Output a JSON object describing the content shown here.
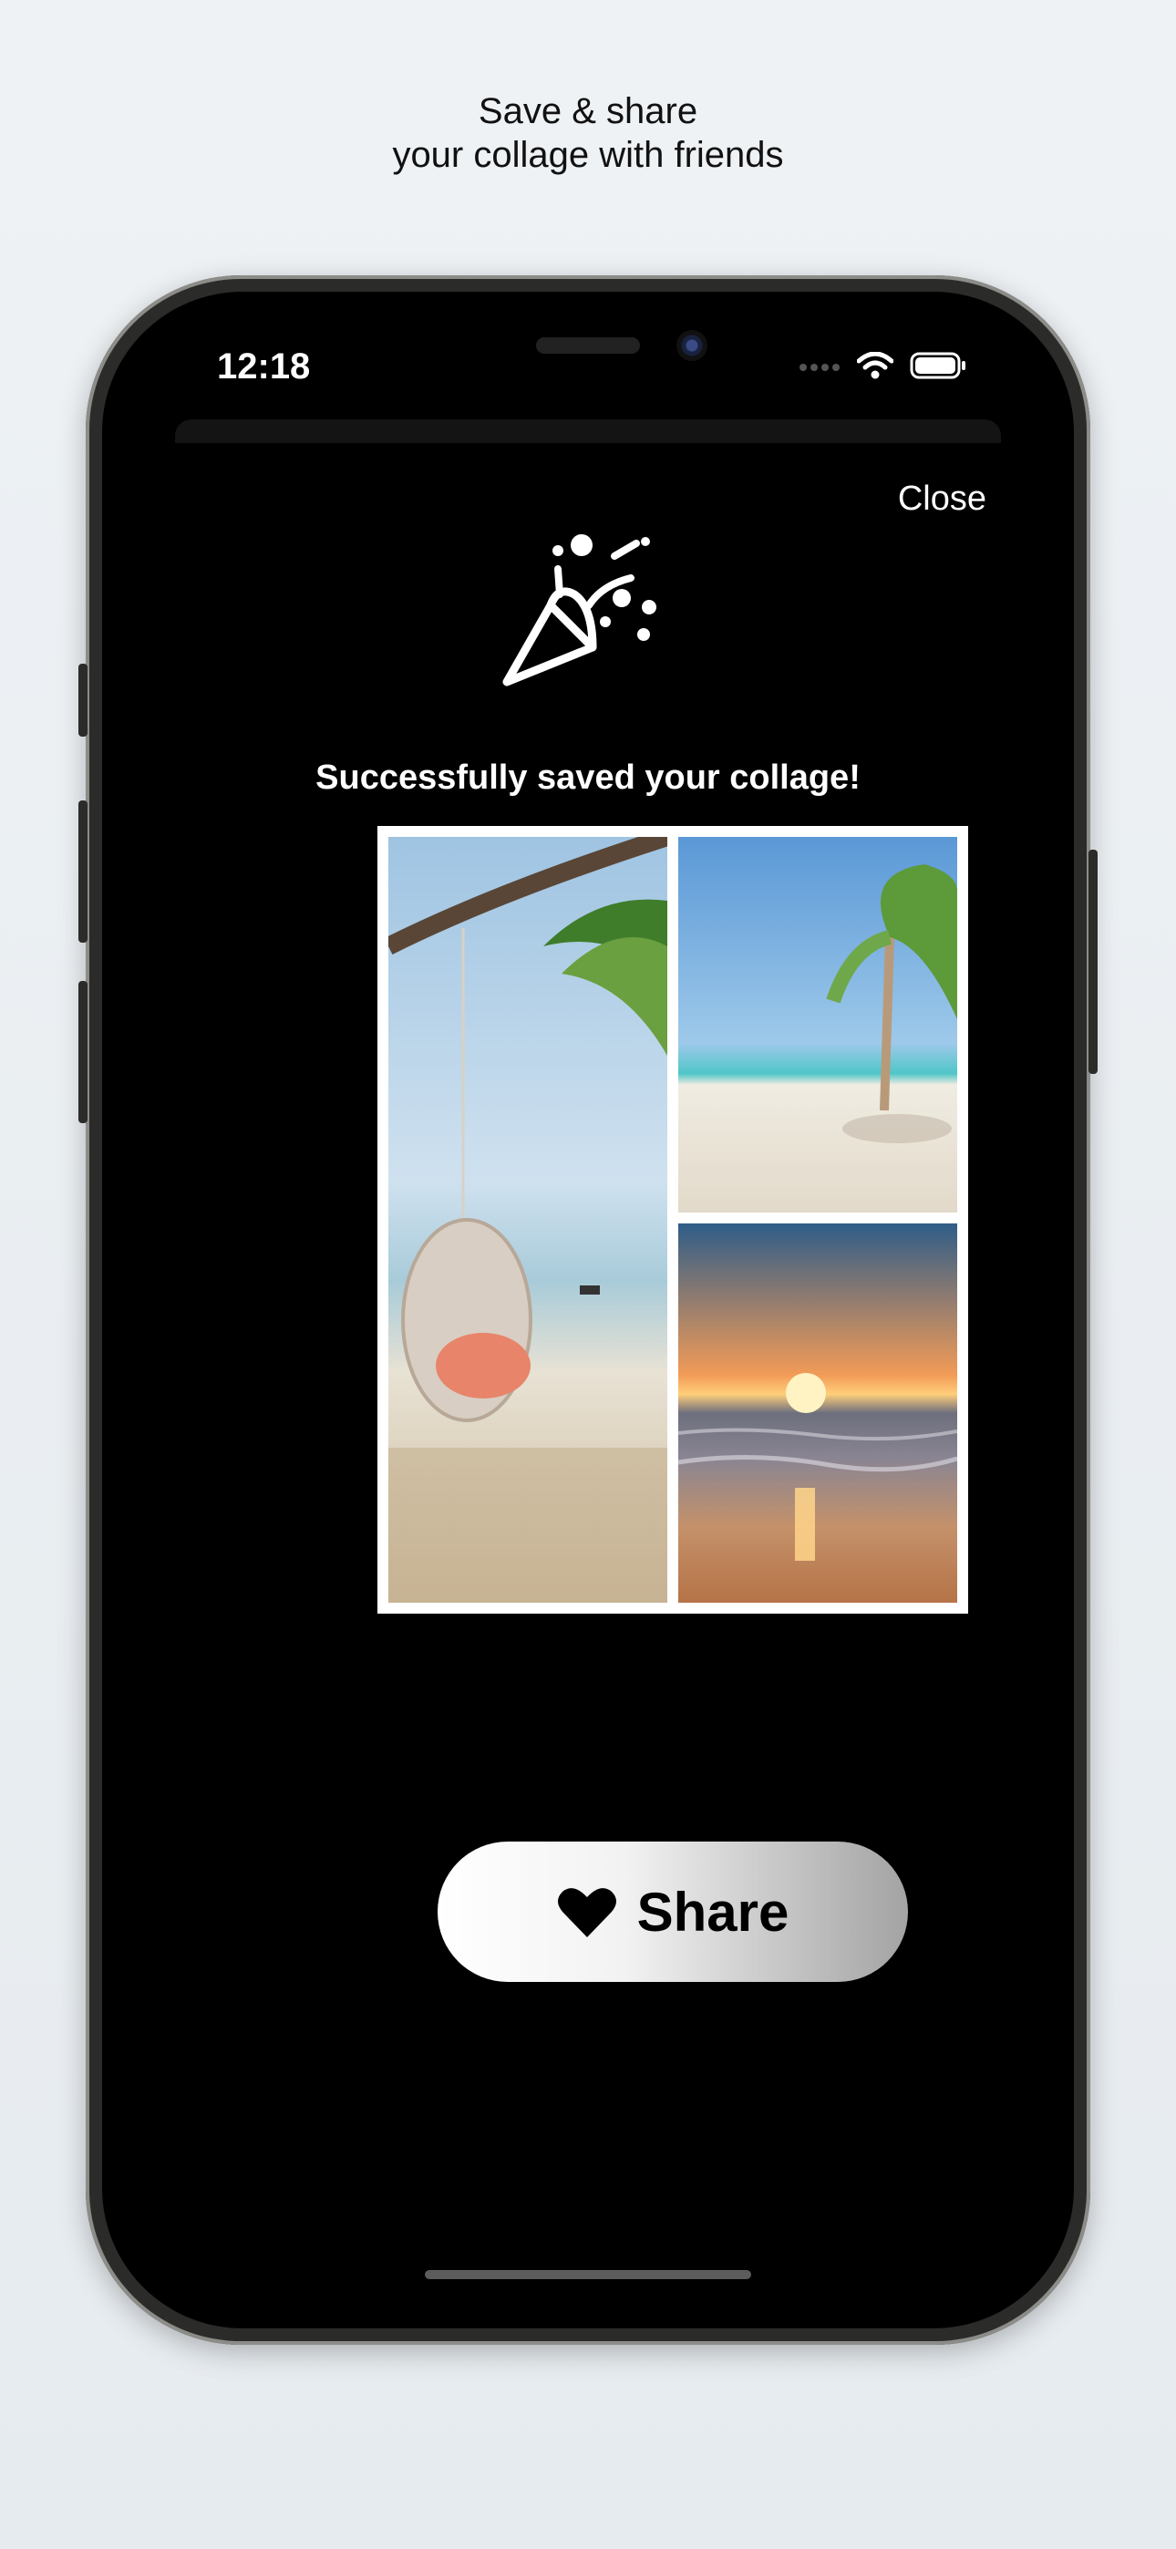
{
  "promo": {
    "line1": "Save & share",
    "line2": "your collage with friends"
  },
  "status_bar": {
    "time": "12:18",
    "icons": [
      "cellular-icon",
      "wifi-icon",
      "battery-icon"
    ]
  },
  "sheet": {
    "close_label": "Close",
    "icon": "party-popper-icon",
    "success_message": "Successfully saved your collage!"
  },
  "collage": {
    "photos": [
      "beach-swing-photo",
      "palm-beach-photo",
      "sunset-beach-photo"
    ]
  },
  "share_button": {
    "label": "Share",
    "icon": "heart-icon"
  },
  "colors": {
    "background": "#eef2f5",
    "screen": "#000000",
    "text_on_dark": "#ffffff"
  }
}
